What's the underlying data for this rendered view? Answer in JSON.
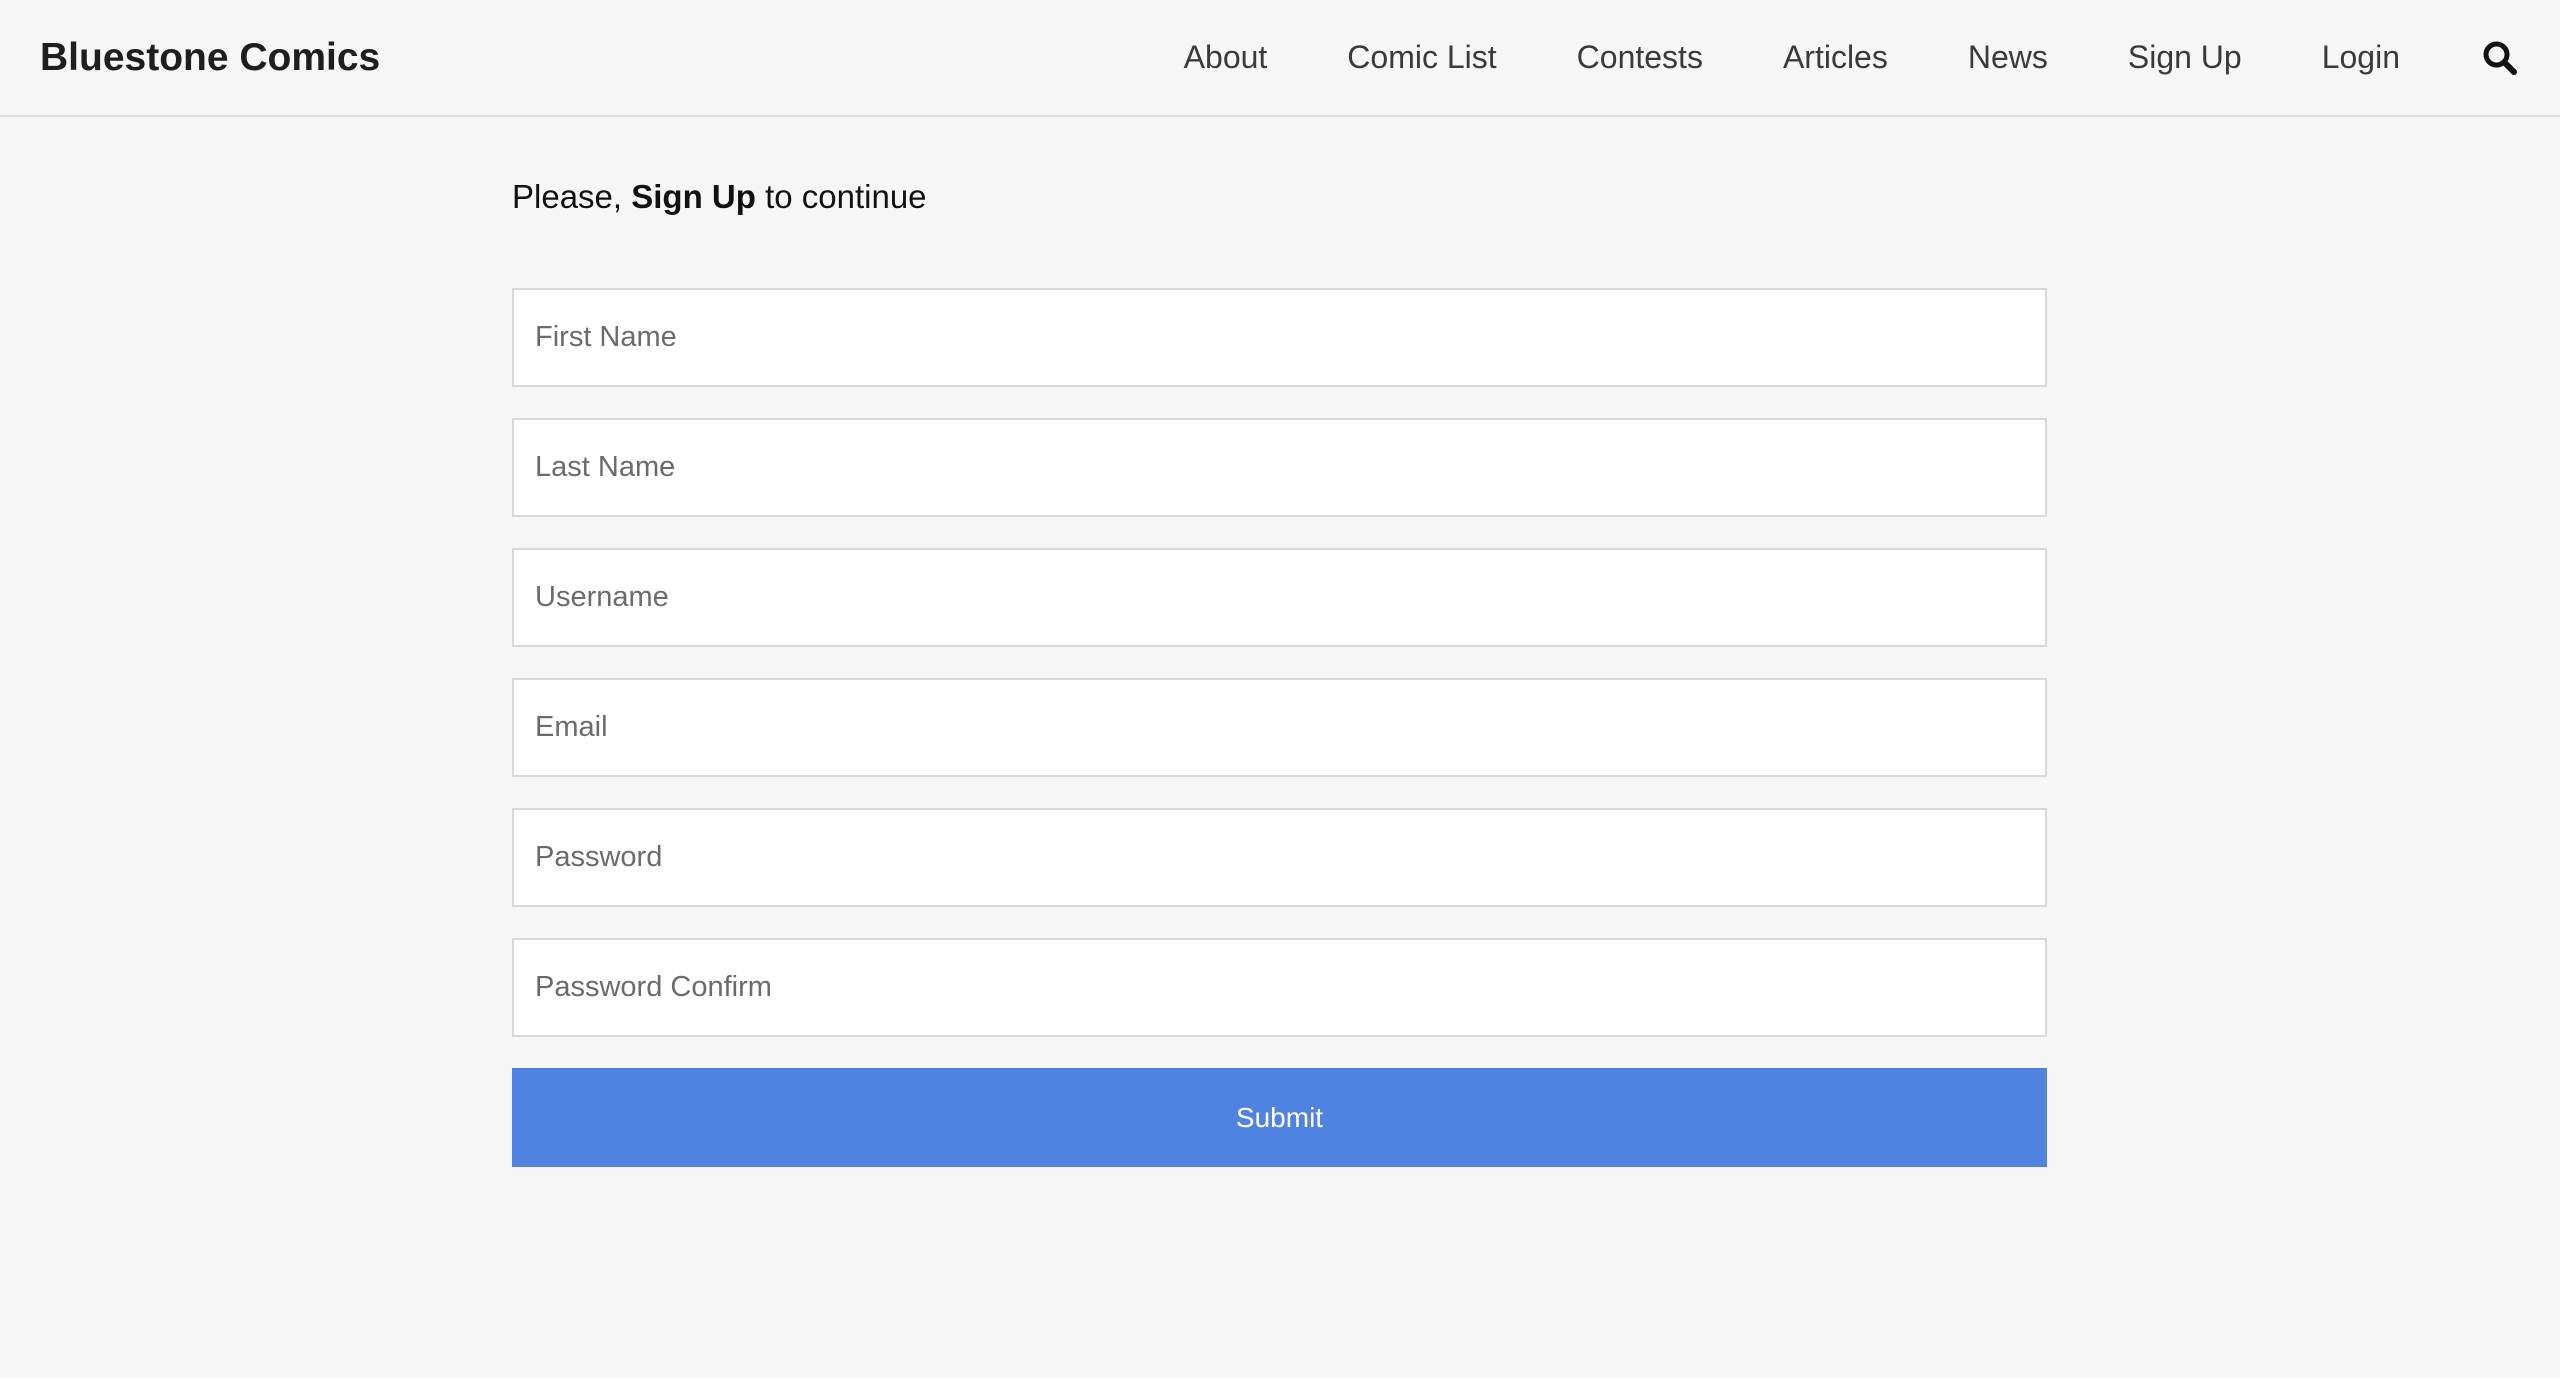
{
  "header": {
    "brand": "Bluestone Comics",
    "nav": [
      {
        "label": "About"
      },
      {
        "label": "Comic List"
      },
      {
        "label": "Contests"
      },
      {
        "label": "Articles"
      },
      {
        "label": "News"
      },
      {
        "label": "Sign Up"
      },
      {
        "label": "Login"
      }
    ],
    "search_icon": "search-icon"
  },
  "prompt": {
    "before": "Please, ",
    "emphasis": "Sign Up",
    "after": " to continue"
  },
  "form": {
    "fields": [
      {
        "placeholder": "First Name",
        "value": ""
      },
      {
        "placeholder": "Last Name",
        "value": ""
      },
      {
        "placeholder": "Username",
        "value": ""
      },
      {
        "placeholder": "Email",
        "value": ""
      },
      {
        "placeholder": "Password",
        "value": ""
      },
      {
        "placeholder": "Password Confirm",
        "value": ""
      }
    ],
    "submit_label": "Submit"
  },
  "colors": {
    "background": "#f5f6f5",
    "accent": "#4f82e1",
    "text": "#222222"
  }
}
